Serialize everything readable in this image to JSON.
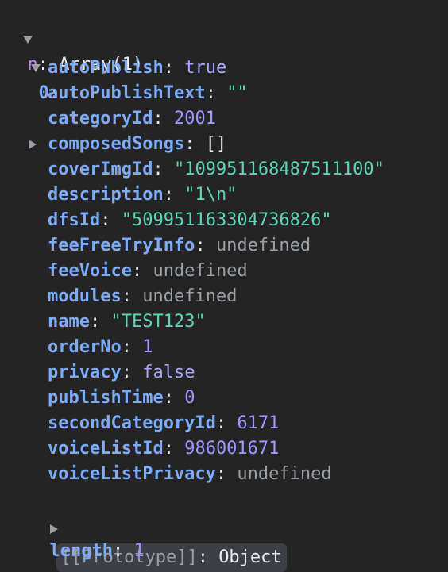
{
  "root": {
    "key": "n",
    "value": "Array(1)"
  },
  "item": {
    "key": "0"
  },
  "props": [
    {
      "key": "autoPublish",
      "value": "true",
      "type": "bool"
    },
    {
      "key": "autoPublishText",
      "value": "\"\"",
      "type": "str"
    },
    {
      "key": "categoryId",
      "value": "2001",
      "type": "num"
    },
    {
      "key": "composedSongs",
      "value": "[]",
      "type": "obj",
      "expandable": true
    },
    {
      "key": "coverImgId",
      "value": "\"109951168487511100\"",
      "type": "str"
    },
    {
      "key": "description",
      "value": "\"1\\n\"",
      "type": "str"
    },
    {
      "key": "dfsId",
      "value": "\"509951163304736826\"",
      "type": "str"
    },
    {
      "key": "feeFreeTryInfo",
      "value": "undefined",
      "type": "undef"
    },
    {
      "key": "feeVoice",
      "value": "undefined",
      "type": "undef"
    },
    {
      "key": "modules",
      "value": "undefined",
      "type": "undef"
    },
    {
      "key": "name",
      "value": "\"TEST123\"",
      "type": "str"
    },
    {
      "key": "orderNo",
      "value": "1",
      "type": "num"
    },
    {
      "key": "privacy",
      "value": "false",
      "type": "bool"
    },
    {
      "key": "publishTime",
      "value": "0",
      "type": "num"
    },
    {
      "key": "secondCategoryId",
      "value": "6171",
      "type": "num"
    },
    {
      "key": "voiceListId",
      "value": "986001671",
      "type": "num"
    },
    {
      "key": "voiceListPrivacy",
      "value": "undefined",
      "type": "undef"
    }
  ],
  "prototype": {
    "key": "[[Prototype]]",
    "value": "Object"
  },
  "length": {
    "key": "length",
    "value": "1"
  },
  "colors": {
    "background": "#242424",
    "key": "#7cacf8",
    "string": "#5cd5b8",
    "number": "#9d98ff",
    "undefined": "#9aa0a6"
  }
}
